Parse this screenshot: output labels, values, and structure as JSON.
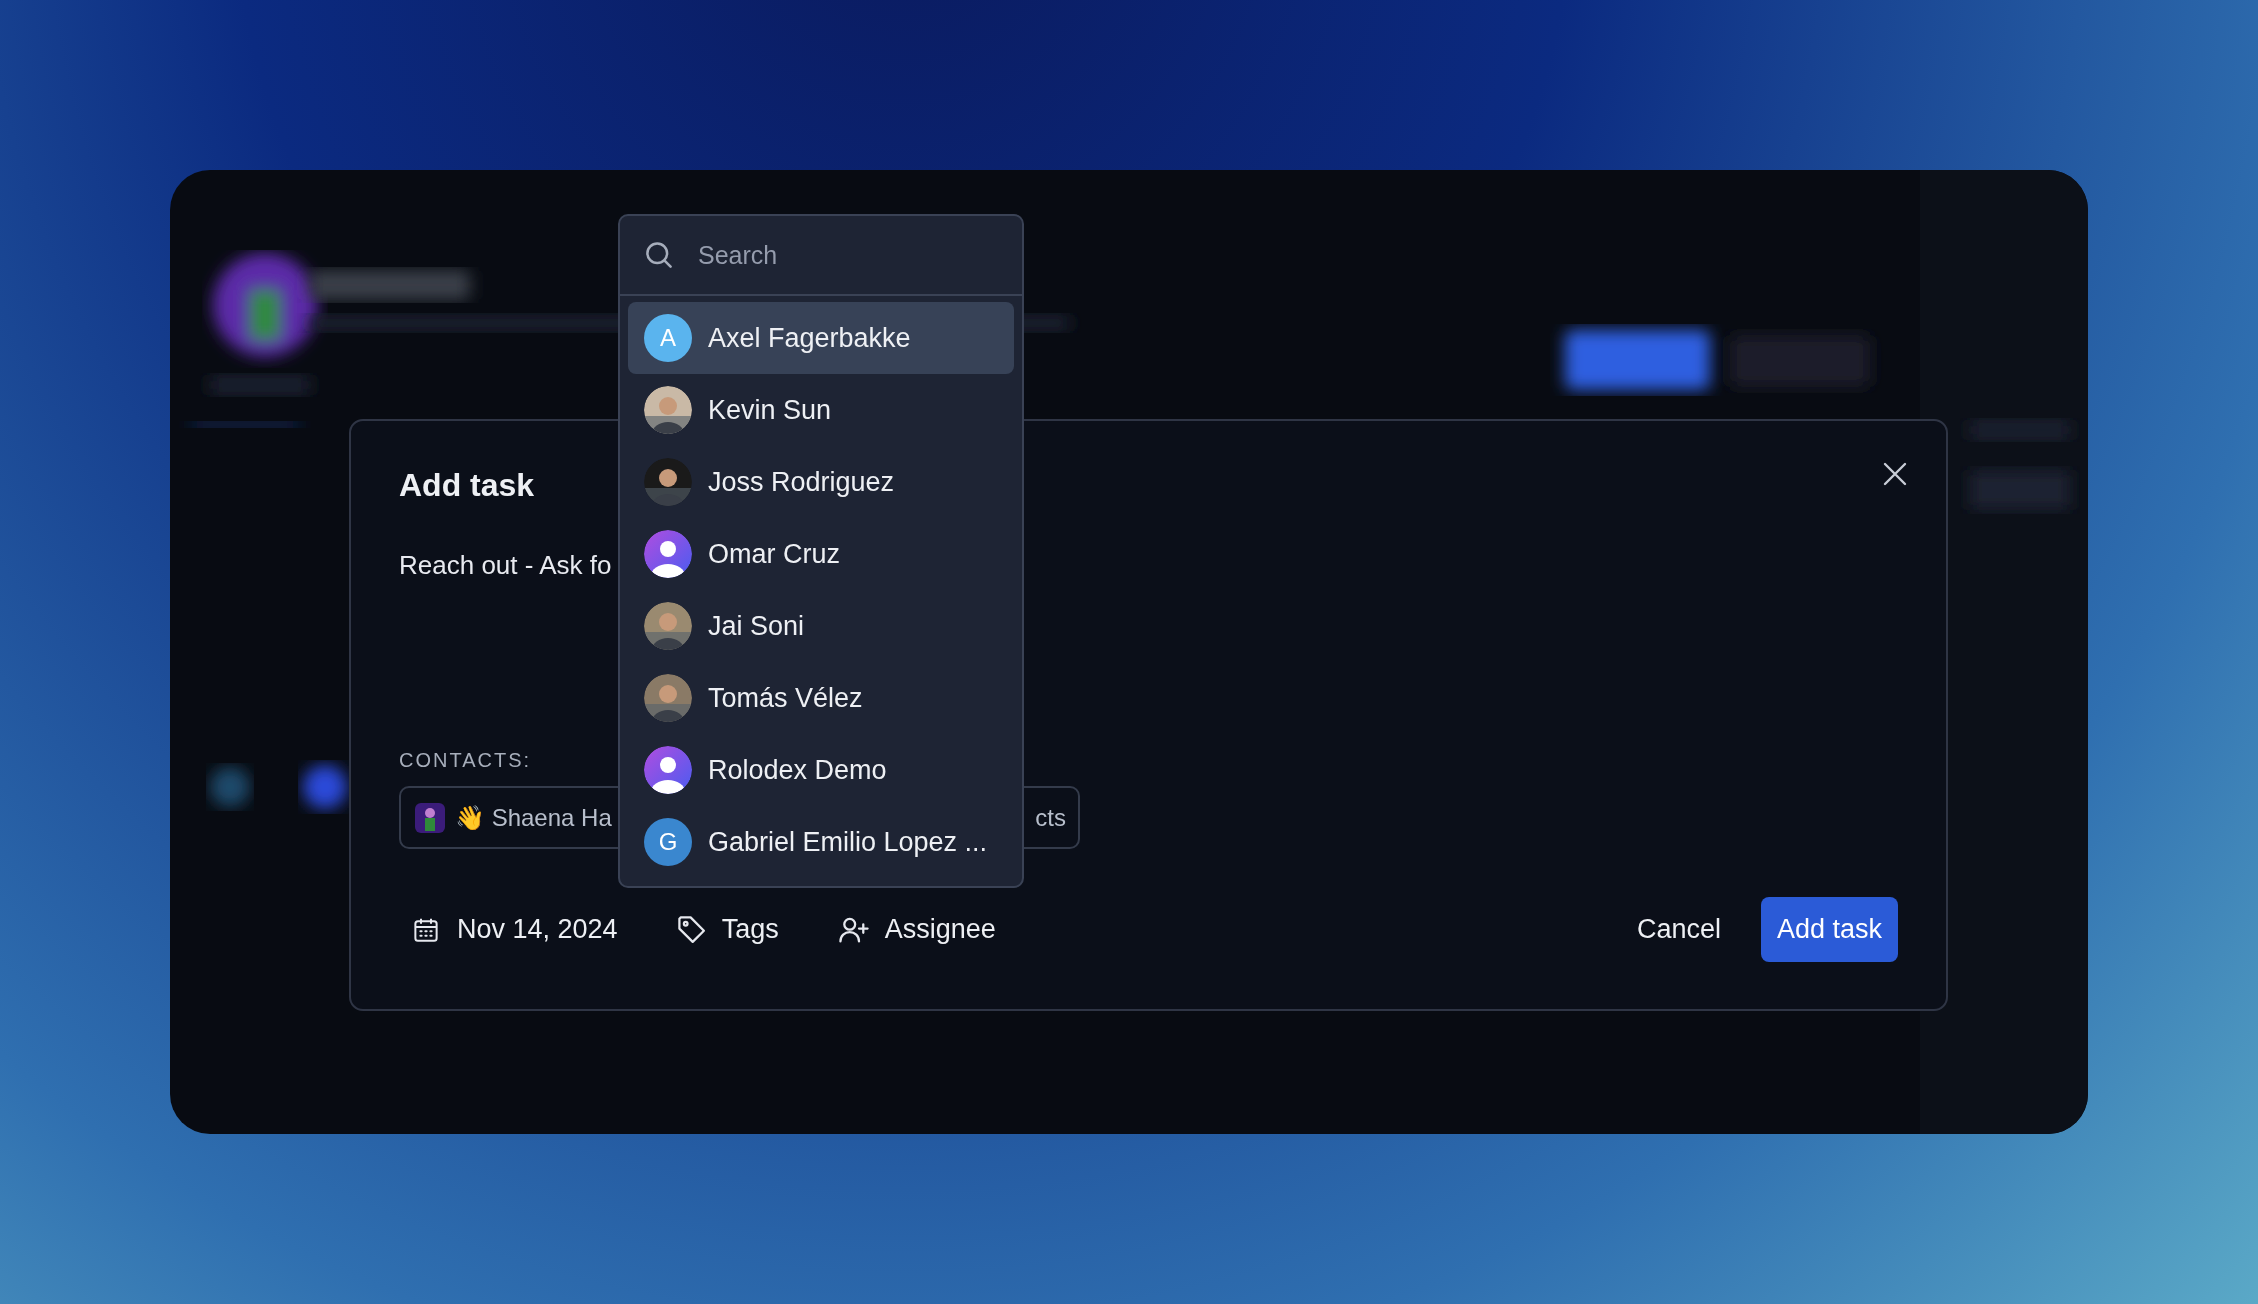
{
  "modal": {
    "title": "Add task",
    "description": "Reach out - Ask fo",
    "contacts_label": "CONTACTS:",
    "contact_chip": {
      "text": "👋 Shaena Ha",
      "trailing_text": "cts"
    },
    "footer": {
      "date": "Nov 14, 2024",
      "tags": "Tags",
      "assignee": "Assignee",
      "cancel": "Cancel",
      "submit": "Add task"
    }
  },
  "assignee_menu": {
    "search": {
      "placeholder": "Search"
    },
    "people": [
      {
        "name": "Axel Fagerbakke",
        "selected": true,
        "avatar": {
          "kind": "letter",
          "letter": "A",
          "color": "#5ab4ee"
        }
      },
      {
        "name": "Kevin Sun",
        "selected": false
      },
      {
        "name": "Joss Rodriguez",
        "selected": false
      },
      {
        "name": "Omar Cruz",
        "selected": false,
        "avatar": {
          "kind": "default"
        }
      },
      {
        "name": "Jai Soni",
        "selected": false
      },
      {
        "name": "Tomás Vélez",
        "selected": false
      },
      {
        "name": "Rolodex Demo",
        "selected": false,
        "avatar": {
          "kind": "default"
        }
      },
      {
        "name": "Gabriel Emilio Lopez ...",
        "selected": false,
        "avatar": {
          "kind": "letter",
          "letter": "G",
          "color": "#3a87cf"
        }
      }
    ]
  }
}
